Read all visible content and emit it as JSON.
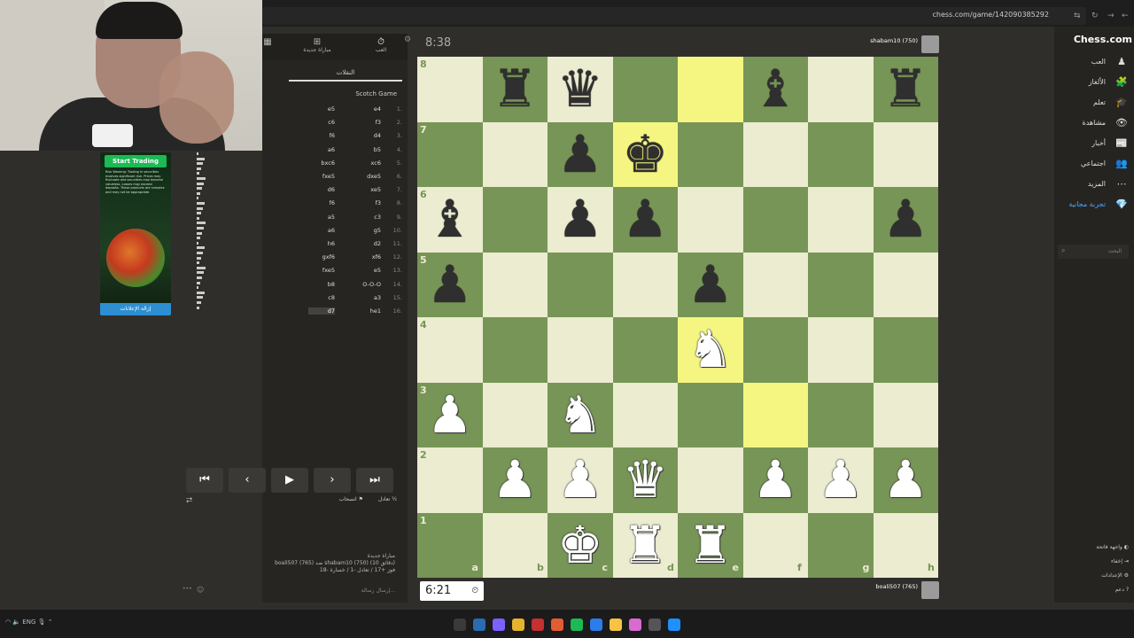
{
  "browser": {
    "url": "chess.com/game/142090385292"
  },
  "sponsor": {
    "cta": "Start Trading",
    "disclaimer": "Risk Warning: Trading in securities involves significant risk. Prices may fluctuate and securities may become valueless. Losses may exceed deposits. These products are complex and may not be appropriate.",
    "remove": "إزالة الإعلانات"
  },
  "panel": {
    "tabs": [
      {
        "label": "العب",
        "icon": "clock-icon"
      },
      {
        "label": "مباراة جديدة",
        "icon": "plus-square-icon"
      },
      {
        "label": "",
        "icon": "board-icon"
      }
    ],
    "moves_tab": "النقلات",
    "opening": "Scotch Game",
    "moves": [
      {
        "n": "1.",
        "w": "e4",
        "b": "e5"
      },
      {
        "n": "2.",
        "w": "f3",
        "b": "c6"
      },
      {
        "n": "3.",
        "w": "d4",
        "b": "f6"
      },
      {
        "n": "4.",
        "w": "b5",
        "b": "a6"
      },
      {
        "n": "5.",
        "w": "xc6",
        "b": "bxc6"
      },
      {
        "n": "6.",
        "w": "dxe5",
        "b": "fxe5"
      },
      {
        "n": "7.",
        "w": "xe5",
        "b": "d6"
      },
      {
        "n": "8.",
        "w": "f3",
        "b": "f6"
      },
      {
        "n": "9.",
        "w": "c3",
        "b": "a5"
      },
      {
        "n": "10.",
        "w": "g5",
        "b": "a6"
      },
      {
        "n": "11.",
        "w": "d2",
        "b": "h6"
      },
      {
        "n": "12.",
        "w": "xf6",
        "b": "gxf6"
      },
      {
        "n": "13.",
        "w": "e5",
        "b": "fxe5"
      },
      {
        "n": "14.",
        "w": "O-O-O",
        "b": "b8"
      },
      {
        "n": "15.",
        "w": "a3",
        "b": "c8"
      },
      {
        "n": "16.",
        "w": "he1",
        "b": "d7"
      }
    ],
    "controls": {
      "first": "⏮",
      "prev": "‹",
      "play": "▶",
      "next": "›",
      "last": "⏭"
    },
    "draw": "تعادل",
    "resign": "انسحاب",
    "result_title": "مباراة جديدة",
    "result_line1": "boali507 (765) ضد shabam10 (750) (10 دقائق)",
    "result_line2": "فوز +17 / تعادل -1 / خسارة -18",
    "chat_placeholder": "إرسال رسالة..."
  },
  "clocks": {
    "top": "8:38",
    "bottom": "6:21"
  },
  "players": {
    "top": "shabam10 (750)",
    "bottom": "boali507 (765)"
  },
  "board": {
    "ranks": [
      "8",
      "7",
      "6",
      "5",
      "4",
      "3",
      "2",
      "1"
    ],
    "files": [
      "a",
      "b",
      "c",
      "d",
      "e",
      "f",
      "g",
      "h"
    ],
    "highlights": [
      "e8",
      "d7",
      "f3",
      "e4"
    ],
    "pieces": [
      {
        "sq": "b8",
        "p": "♜",
        "c": "b"
      },
      {
        "sq": "c8",
        "p": "♛",
        "c": "b"
      },
      {
        "sq": "f8",
        "p": "♝",
        "c": "b"
      },
      {
        "sq": "h8",
        "p": "♜",
        "c": "b"
      },
      {
        "sq": "c7",
        "p": "♟",
        "c": "b"
      },
      {
        "sq": "d7",
        "p": "♚",
        "c": "b"
      },
      {
        "sq": "a6",
        "p": "♝",
        "c": "b"
      },
      {
        "sq": "c6",
        "p": "♟",
        "c": "b"
      },
      {
        "sq": "d6",
        "p": "♟",
        "c": "b"
      },
      {
        "sq": "h6",
        "p": "♟",
        "c": "b"
      },
      {
        "sq": "a5",
        "p": "♟",
        "c": "b"
      },
      {
        "sq": "e5",
        "p": "♟",
        "c": "b"
      },
      {
        "sq": "e4",
        "p": "♞",
        "c": "w"
      },
      {
        "sq": "a3",
        "p": "♟",
        "c": "w"
      },
      {
        "sq": "c3",
        "p": "♞",
        "c": "w"
      },
      {
        "sq": "b2",
        "p": "♟",
        "c": "w"
      },
      {
        "sq": "c2",
        "p": "♟",
        "c": "w"
      },
      {
        "sq": "d2",
        "p": "♛",
        "c": "w"
      },
      {
        "sq": "f2",
        "p": "♟",
        "c": "w"
      },
      {
        "sq": "g2",
        "p": "♟",
        "c": "w"
      },
      {
        "sq": "h2",
        "p": "♟",
        "c": "w"
      },
      {
        "sq": "c1",
        "p": "♚",
        "c": "w"
      },
      {
        "sq": "d1",
        "p": "♜",
        "c": "w"
      },
      {
        "sq": "e1",
        "p": "♜",
        "c": "w"
      }
    ]
  },
  "sitenav": {
    "logo": "Chess.com",
    "items": [
      {
        "label": "العب",
        "icon": "pawn-icon"
      },
      {
        "label": "الألغاز",
        "icon": "puzzle-icon"
      },
      {
        "label": "تعلم",
        "icon": "learn-icon"
      },
      {
        "label": "مشاهدة",
        "icon": "watch-icon"
      },
      {
        "label": "أخبار",
        "icon": "news-icon"
      },
      {
        "label": "اجتماعي",
        "icon": "social-icon"
      },
      {
        "label": "المزيد",
        "icon": "more-icon"
      },
      {
        "label": "تجربة مجانية",
        "icon": "diamond-icon"
      }
    ],
    "search": "البحث",
    "bottom": [
      "واجهة فاتحة",
      "إخفاء",
      "الإعدادات",
      "دعم"
    ]
  },
  "taskbar": {
    "lang": "ENG"
  },
  "colors": {
    "light": "#ebecd0",
    "dark": "#779556",
    "highlight": "#f5f682",
    "accent": "#81b64c"
  }
}
